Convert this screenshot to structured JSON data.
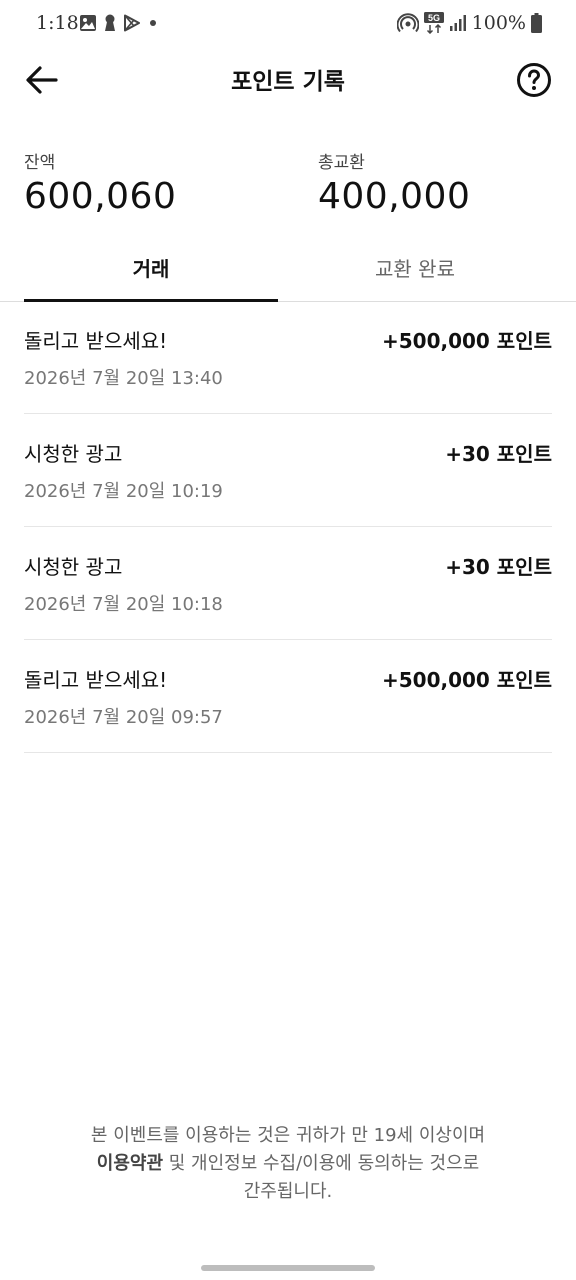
{
  "status_bar": {
    "time": "1:18",
    "battery": "100%",
    "network": "5G",
    "left_icons": [
      "gallery-icon",
      "keyhole-icon",
      "play-store-icon",
      "dot-icon"
    ],
    "right_icons": [
      "hotspot-icon",
      "network-5g-icon",
      "signal-icon",
      "battery-icon"
    ]
  },
  "header": {
    "title": "포인트 기록",
    "back_icon": "arrow-left-icon",
    "help_icon": "question-circle-icon"
  },
  "summary": {
    "balance_label": "잔액",
    "balance_value": "600,060",
    "exchanged_label": "총교환",
    "exchanged_value": "400,000"
  },
  "tabs": [
    {
      "label": "거래",
      "active": true
    },
    {
      "label": "교환 완료",
      "active": false
    }
  ],
  "transactions": [
    {
      "title": "돌리고 받으세요!",
      "date": "2026년 7월 20일 13:40",
      "amount": "+500,000 포인트"
    },
    {
      "title": "시청한 광고",
      "date": "2026년 7월 20일 10:19",
      "amount": "+30 포인트"
    },
    {
      "title": "시청한 광고",
      "date": "2026년 7월 20일 10:18",
      "amount": "+30 포인트"
    },
    {
      "title": "돌리고 받으세요!",
      "date": "2026년 7월 20일 09:57",
      "amount": "+500,000 포인트"
    }
  ],
  "footer": {
    "line1": "본 이벤트를 이용하는 것은 귀하가 만 19세 이상이며",
    "terms_link": "이용약관",
    "line2_rest": " 및 개인정보 수집/이용에 동의하는 것으로",
    "line3": "간주됩니다."
  }
}
